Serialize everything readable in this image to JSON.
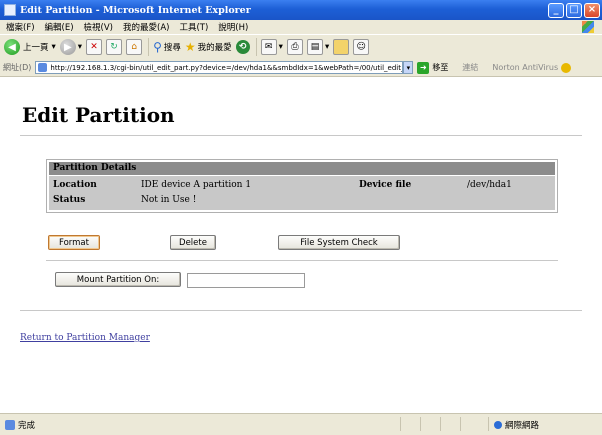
{
  "window": {
    "title": "Edit Partition - Microsoft Internet Explorer"
  },
  "menu": [
    "檔案(F)",
    "編輯(E)",
    "檢視(V)",
    "我的最愛(A)",
    "工具(T)",
    "說明(H)"
  ],
  "toolbar": {
    "back_label": "上一頁",
    "search_label": "搜尋",
    "favorites_label": "我的最愛"
  },
  "address": {
    "label": "網址(D)",
    "url": "http://192.168.1.3/cgi-bin/util_edit_part.py?device=/dev/hda1&&smbdIdx=1&webPath=/00/util_edit_",
    "go_label": "移至",
    "links_label": "連結",
    "norton_label": "Norton AntiVirus"
  },
  "page": {
    "title": "Edit Partition",
    "panel": {
      "header": "Partition Details",
      "location_label": "Location",
      "location_value": "IDE device A partition 1",
      "device_file_label": "Device file",
      "device_file_value": "/dev/hda1",
      "status_label": "Status",
      "status_value": "Not in Use !"
    },
    "buttons": {
      "format": "Format",
      "delete": "Delete",
      "fs_check": "File System Check",
      "mount": "Mount Partition On:"
    },
    "mount_input_value": "",
    "return_link": "Return to Partition Manager"
  },
  "status": {
    "text": "完成",
    "zone": "網際網路"
  }
}
